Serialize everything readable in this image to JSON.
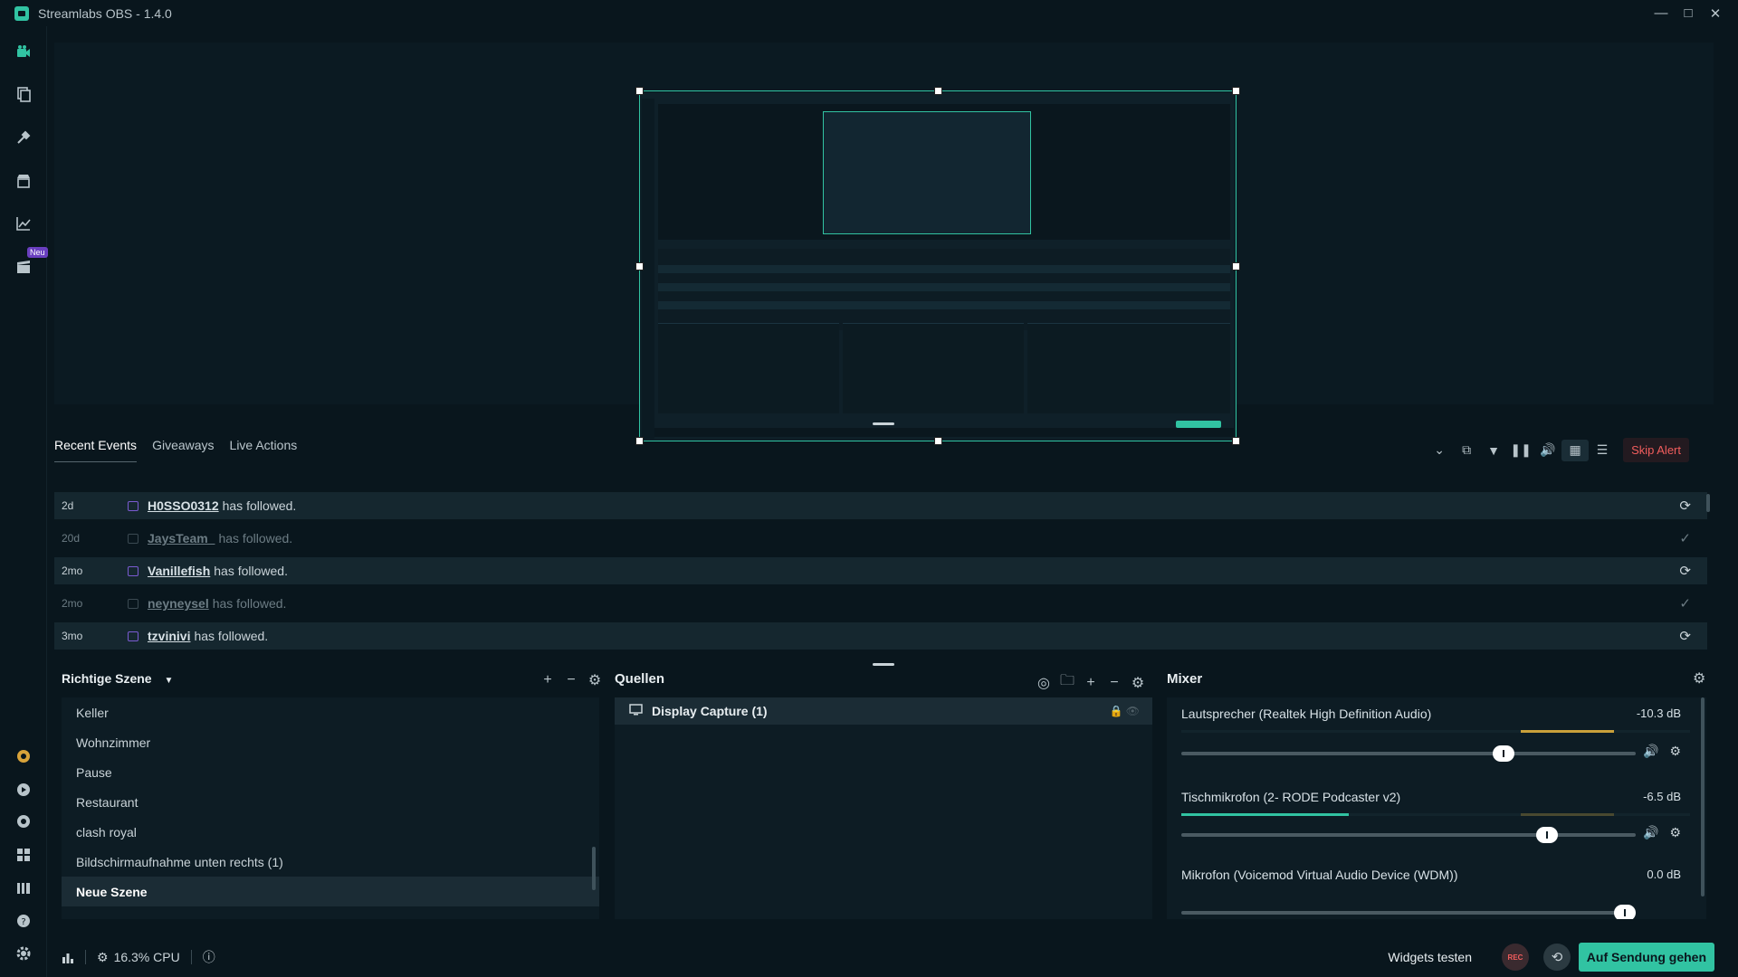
{
  "window": {
    "title": "Streamlabs OBS - 1.4.0"
  },
  "sidebar": {
    "new_badge": "Neu"
  },
  "events": {
    "tabs": [
      {
        "label": "Recent Events"
      },
      {
        "label": "Giveaways"
      },
      {
        "label": "Live Actions"
      }
    ],
    "skip_alert": "Skip Alert",
    "rows": [
      {
        "time": "2d",
        "user": "H0SSO0312",
        "message": "has followed.",
        "faded": false
      },
      {
        "time": "20d",
        "user": "JaysTeam_",
        "message": "has followed.",
        "faded": true
      },
      {
        "time": "2mo",
        "user": "Vanillefish",
        "message": "has followed.",
        "faded": false
      },
      {
        "time": "2mo",
        "user": "neyneysel",
        "message": "has followed.",
        "faded": true
      },
      {
        "time": "3mo",
        "user": "tzvinivi",
        "message": "has followed.",
        "faded": false
      }
    ]
  },
  "scenes": {
    "title": "Richtige Szene",
    "items": [
      {
        "label": "Keller"
      },
      {
        "label": "Wohnzimmer"
      },
      {
        "label": "Pause"
      },
      {
        "label": "Restaurant"
      },
      {
        "label": "clash royal"
      },
      {
        "label": "Bildschirmaufnahme unten rechts (1)"
      },
      {
        "label": "Neue Szene"
      }
    ],
    "active_index": 6
  },
  "sources": {
    "title": "Quellen",
    "items": [
      {
        "label": "Display Capture (1)"
      }
    ]
  },
  "mixer": {
    "title": "Mixer",
    "channels": [
      {
        "name": "Lautsprecher (Realtek High Definition Audio)",
        "db": "-10.3 dB",
        "volume": 0.72,
        "level": 0.0
      },
      {
        "name": "Tischmikrofon (2- RODE Podcaster v2)",
        "db": "-6.5 dB",
        "volume": 0.82,
        "level": 0.33
      },
      {
        "name": "Mikrofon (Voicemod Virtual Audio Device (WDM))",
        "db": "0.0 dB",
        "volume": 1.0,
        "level": 0.0
      }
    ]
  },
  "footer": {
    "cpu": "16.3% CPU",
    "widgets_test": "Widgets testen",
    "rec": "REC",
    "go_live": "Auf Sendung gehen"
  },
  "colors": {
    "accent": "#31c3a2",
    "danger": "#f25d5d",
    "background": "#09161d"
  }
}
